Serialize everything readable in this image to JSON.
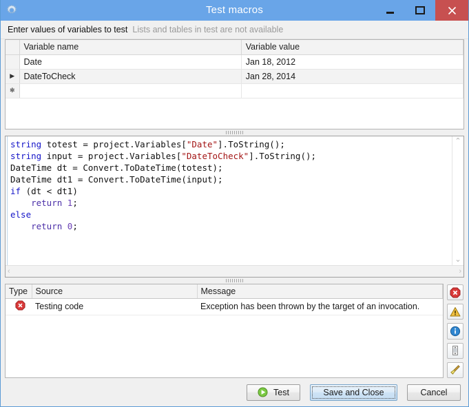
{
  "window": {
    "title": "Test macros",
    "app_icon": "gear-icon",
    "controls": {
      "minimize": "minimize-icon",
      "maximize": "maximize-icon",
      "close": "close-icon"
    }
  },
  "instruction": {
    "primary": "Enter values of variables to test",
    "secondary": "Lists and tables in test are not available"
  },
  "variables_grid": {
    "columns": [
      "Variable name",
      "Variable value"
    ],
    "rows": [
      {
        "marker": "",
        "name": "Date",
        "value": "Jan 18, 2012",
        "current": false
      },
      {
        "marker": "▶",
        "name": "DateToCheck",
        "value": "Jan 28, 2014",
        "current": true
      },
      {
        "marker": "✻",
        "name": "",
        "value": "",
        "current": false
      }
    ]
  },
  "code_editor": {
    "lines": [
      [
        {
          "t": "string",
          "c": "kw"
        },
        {
          "t": " totest = project.Variables[",
          "c": ""
        },
        {
          "t": "\"Date\"",
          "c": "str"
        },
        {
          "t": "].ToString();",
          "c": ""
        }
      ],
      [
        {
          "t": "string",
          "c": "kw"
        },
        {
          "t": " input = project.Variables[",
          "c": ""
        },
        {
          "t": "\"DateToCheck\"",
          "c": "str"
        },
        {
          "t": "].ToString();",
          "c": ""
        }
      ],
      [
        {
          "t": "DateTime dt = Convert.ToDateTime(totest);",
          "c": ""
        }
      ],
      [
        {
          "t": "DateTime dt1 = Convert.ToDateTime(input);",
          "c": ""
        }
      ],
      [
        {
          "t": "if",
          "c": "kw"
        },
        {
          "t": " (dt < dt1)",
          "c": ""
        }
      ],
      [
        {
          "t": "    ",
          "c": ""
        },
        {
          "t": "return",
          "c": "ret"
        },
        {
          "t": " ",
          "c": ""
        },
        {
          "t": "1",
          "c": "num"
        },
        {
          "t": ";",
          "c": ""
        }
      ],
      [
        {
          "t": "else",
          "c": "kw"
        }
      ],
      [
        {
          "t": "    ",
          "c": ""
        },
        {
          "t": "return",
          "c": "ret"
        },
        {
          "t": " ",
          "c": ""
        },
        {
          "t": "0",
          "c": "num"
        },
        {
          "t": ";",
          "c": ""
        }
      ]
    ],
    "scrollbars": {
      "up_arrow": "⌃",
      "down_arrow": "⌄",
      "left_arrow": "‹",
      "right_arrow": "›"
    }
  },
  "messages_panel": {
    "columns": [
      "Type",
      "Source",
      "Message"
    ],
    "rows": [
      {
        "type_icon": "error-icon",
        "source": "Testing code",
        "message": "Exception has been thrown by the target of an invocation."
      }
    ],
    "toolbar": [
      {
        "name": "filter-errors-button",
        "icon": "error-icon"
      },
      {
        "name": "filter-warnings-button",
        "icon": "warning-icon"
      },
      {
        "name": "filter-info-button",
        "icon": "info-icon"
      },
      {
        "name": "autoscroll-button",
        "icon": "scroll-lock-icon"
      },
      {
        "name": "clear-messages-button",
        "icon": "broom-icon"
      }
    ]
  },
  "footer": {
    "test_label": "Test",
    "save_label": "Save and Close",
    "cancel_label": "Cancel",
    "test_icon": "play-icon"
  },
  "colors": {
    "titlebar": "#69a5e8",
    "close_button": "#c75050",
    "error_red": "#d93a3a",
    "warning_yellow": "#e8b53a",
    "info_blue": "#2f86d0",
    "play_green": "#6cbf2f",
    "keyword_blue": "#1414c8",
    "string_red": "#a31515",
    "number_purple": "#6a3fb5"
  }
}
